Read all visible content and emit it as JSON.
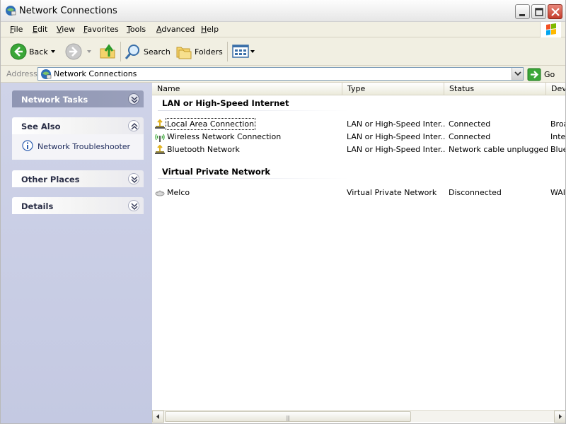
{
  "window": {
    "title": "Network Connections"
  },
  "menu": {
    "items": [
      "File",
      "Edit",
      "View",
      "Favorites",
      "Tools",
      "Advanced",
      "Help"
    ]
  },
  "toolbar": {
    "back_label": "Back",
    "search_label": "Search",
    "folders_label": "Folders"
  },
  "address": {
    "label": "Address",
    "value": "Network Connections",
    "go_label": "Go"
  },
  "sidebar": {
    "network_tasks_title": "Network Tasks",
    "see_also_title": "See Also",
    "see_also_items": [
      "Network Troubleshooter"
    ],
    "other_places_title": "Other Places",
    "details_title": "Details"
  },
  "columns": [
    "Name",
    "Type",
    "Status",
    "Dev"
  ],
  "groups": [
    {
      "title": "LAN or High-Speed Internet",
      "rows": [
        {
          "name": "Local Area Connection",
          "type": "LAN or High-Speed Inter...",
          "status": "Connected",
          "device": "Broa",
          "icon": "lan-icon"
        },
        {
          "name": "Wireless Network Connection",
          "type": "LAN or High-Speed Inter...",
          "status": "Connected",
          "device": "Inte",
          "icon": "wireless-icon"
        },
        {
          "name": "Bluetooth Network",
          "type": "LAN or High-Speed Inter...",
          "status": "Network cable unplugged",
          "device": "Blue",
          "icon": "lan-icon"
        }
      ]
    },
    {
      "title": "Virtual Private Network",
      "rows": [
        {
          "name": "Melco",
          "type": "Virtual Private Network",
          "status": "Disconnected",
          "device": "WAI",
          "icon": "vpn-icon"
        }
      ]
    }
  ],
  "colors": {
    "title_text": "#000000",
    "sidebar_bg": "#c8cce4",
    "link": "#1d2a5b",
    "address_border": "#7f9db9"
  }
}
